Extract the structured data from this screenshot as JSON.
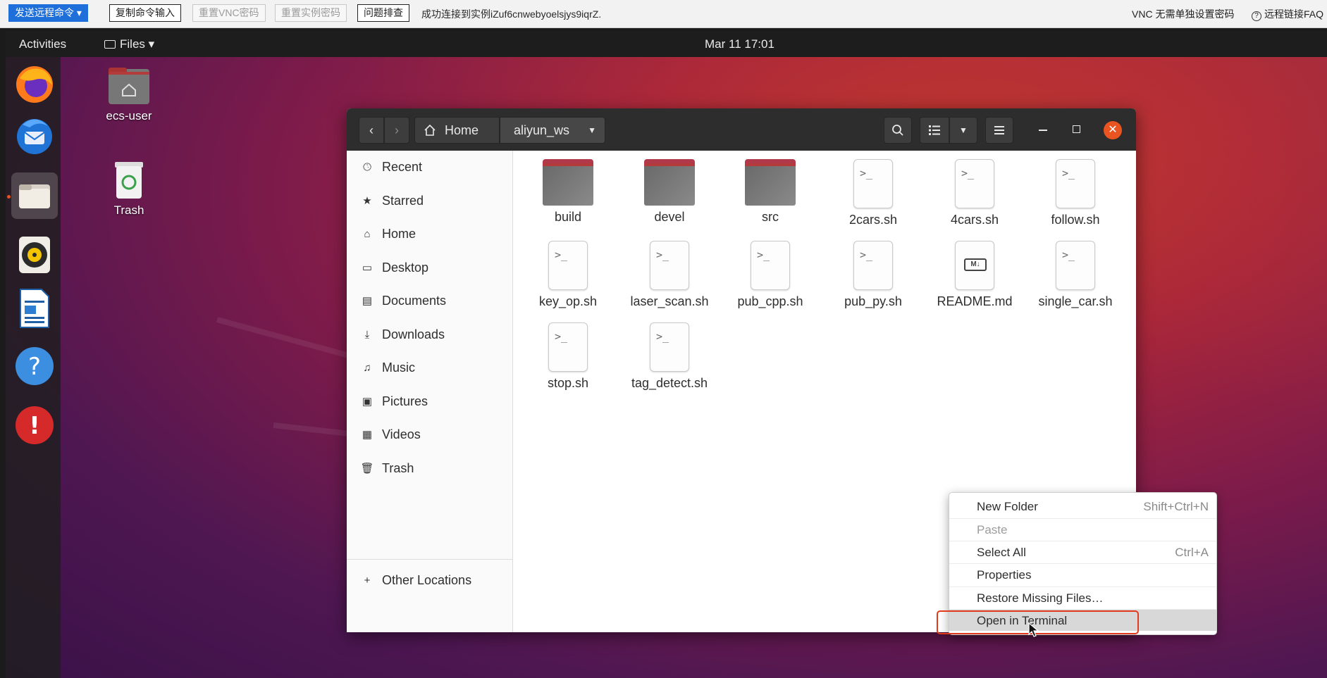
{
  "vnc_toolbar": {
    "send_command": "发送远程命令",
    "copy_input": "复制命令输入",
    "reset_vnc_password": "重置VNC密码",
    "reset_instance_password": "重置实例密码",
    "troubleshoot": "问题排查",
    "status": "成功连接到实例iZuf6cnwebyoelsjys9iqrZ.",
    "no_password_note": "VNC 无需单独设置密码",
    "faq": "远程链接FAQ"
  },
  "topbar": {
    "activities": "Activities",
    "app_menu": "Files",
    "clock": "Mar 11  17:01"
  },
  "dock": {
    "items": [
      {
        "name": "firefox-icon"
      },
      {
        "name": "thunderbird-icon"
      },
      {
        "name": "files-icon",
        "active": true
      },
      {
        "name": "rhythmbox-icon"
      },
      {
        "name": "writer-icon"
      },
      {
        "name": "help-icon"
      },
      {
        "name": "update-icon"
      }
    ]
  },
  "desktop_icons": {
    "home": "ecs-user",
    "trash": "Trash"
  },
  "window": {
    "path_home": "Home",
    "path_current": "aliyun_ws",
    "sidebar": [
      {
        "label": "Recent",
        "icon": "clock-icon"
      },
      {
        "label": "Starred",
        "icon": "star-icon"
      },
      {
        "label": "Home",
        "icon": "home-icon"
      },
      {
        "label": "Desktop",
        "icon": "desktop-icon"
      },
      {
        "label": "Documents",
        "icon": "documents-icon"
      },
      {
        "label": "Downloads",
        "icon": "downloads-icon"
      },
      {
        "label": "Music",
        "icon": "music-icon"
      },
      {
        "label": "Pictures",
        "icon": "pictures-icon"
      },
      {
        "label": "Videos",
        "icon": "videos-icon"
      },
      {
        "label": "Trash",
        "icon": "trash-icon"
      }
    ],
    "other_locations": "Other Locations",
    "files": [
      {
        "name": "build",
        "type": "folder"
      },
      {
        "name": "devel",
        "type": "folder"
      },
      {
        "name": "src",
        "type": "folder"
      },
      {
        "name": "2cars.sh",
        "type": "script"
      },
      {
        "name": "4cars.sh",
        "type": "script"
      },
      {
        "name": "follow.sh",
        "type": "script"
      },
      {
        "name": "key_op.sh",
        "type": "script"
      },
      {
        "name": "laser_scan.sh",
        "type": "script"
      },
      {
        "name": "pub_cpp.sh",
        "type": "script"
      },
      {
        "name": "pub_py.sh",
        "type": "script"
      },
      {
        "name": "README.md",
        "type": "markdown"
      },
      {
        "name": "single_car.sh",
        "type": "script"
      },
      {
        "name": "stop.sh",
        "type": "script"
      },
      {
        "name": "tag_detect.sh",
        "type": "script"
      }
    ],
    "script_glyph": ">_",
    "markdown_glyph": "M↓"
  },
  "context_menu": {
    "items": [
      {
        "label": "New Folder",
        "accel": "Shift+Ctrl+N"
      },
      {
        "label": "Paste",
        "accel": "",
        "disabled": true
      },
      {
        "label": "Select All",
        "accel": "Ctrl+A"
      },
      {
        "label": "Properties",
        "accel": ""
      },
      {
        "label": "Restore Missing Files…",
        "accel": ""
      },
      {
        "label": "Open in Terminal",
        "accel": "",
        "highlighted": true
      }
    ]
  },
  "colors": {
    "accent": "#e95420",
    "highlight_outline": "#e03b1f",
    "vnc_primary": "#1e6fd9"
  }
}
